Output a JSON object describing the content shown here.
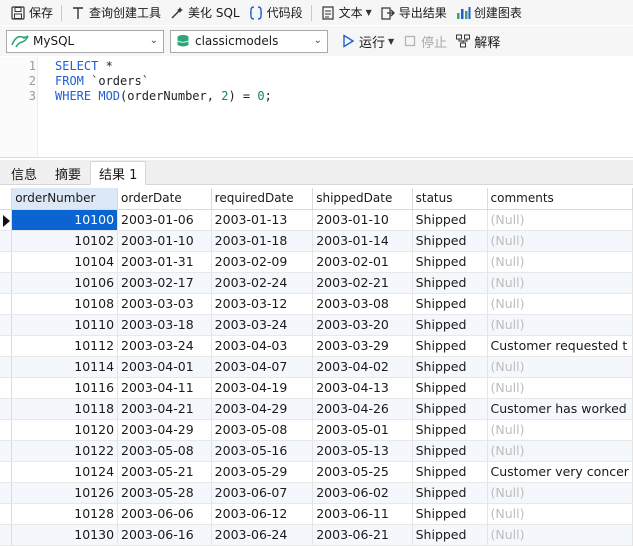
{
  "toolbar": {
    "save": "保存",
    "query_builder": "查询创建工具",
    "beautify_sql": "美化 SQL",
    "code_snippet": "代码段",
    "text": "文本",
    "export_results": "导出结果",
    "create_chart": "创建图表"
  },
  "connection": {
    "server": "MySQL",
    "database": "classicmodels",
    "run": "运行",
    "stop": "停止",
    "explain": "解释"
  },
  "editor": {
    "line_numbers": [
      "1",
      "2",
      "3"
    ],
    "lines": [
      {
        "kw": "SELECT",
        "rest": " *"
      },
      {
        "kw": "FROM",
        "rest": " `orders`"
      },
      {
        "kw": "WHERE",
        "fn": "MOD",
        "args": "(orderNumber, ",
        "num": "2",
        "tail": ") = ",
        "num2": "0",
        "end": ";"
      }
    ]
  },
  "tabs": [
    "信息",
    "摘要",
    "结果 1"
  ],
  "results": {
    "columns": [
      "orderNumber",
      "orderDate",
      "requiredDate",
      "shippedDate",
      "status",
      "comments"
    ],
    "rows": [
      [
        "10100",
        "2003-01-06",
        "2003-01-13",
        "2003-01-10",
        "Shipped",
        "(Null)"
      ],
      [
        "10102",
        "2003-01-10",
        "2003-01-18",
        "2003-01-14",
        "Shipped",
        "(Null)"
      ],
      [
        "10104",
        "2003-01-31",
        "2003-02-09",
        "2003-02-01",
        "Shipped",
        "(Null)"
      ],
      [
        "10106",
        "2003-02-17",
        "2003-02-24",
        "2003-02-21",
        "Shipped",
        "(Null)"
      ],
      [
        "10108",
        "2003-03-03",
        "2003-03-12",
        "2003-03-08",
        "Shipped",
        "(Null)"
      ],
      [
        "10110",
        "2003-03-18",
        "2003-03-24",
        "2003-03-20",
        "Shipped",
        "(Null)"
      ],
      [
        "10112",
        "2003-03-24",
        "2003-04-03",
        "2003-03-29",
        "Shipped",
        "Customer requested t"
      ],
      [
        "10114",
        "2003-04-01",
        "2003-04-07",
        "2003-04-02",
        "Shipped",
        "(Null)"
      ],
      [
        "10116",
        "2003-04-11",
        "2003-04-19",
        "2003-04-13",
        "Shipped",
        "(Null)"
      ],
      [
        "10118",
        "2003-04-21",
        "2003-04-29",
        "2003-04-26",
        "Shipped",
        "Customer has worked"
      ],
      [
        "10120",
        "2003-04-29",
        "2003-05-08",
        "2003-05-01",
        "Shipped",
        "(Null)"
      ],
      [
        "10122",
        "2003-05-08",
        "2003-05-16",
        "2003-05-13",
        "Shipped",
        "(Null)"
      ],
      [
        "10124",
        "2003-05-21",
        "2003-05-29",
        "2003-05-25",
        "Shipped",
        "Customer very concer"
      ],
      [
        "10126",
        "2003-05-28",
        "2003-06-07",
        "2003-06-02",
        "Shipped",
        "(Null)"
      ],
      [
        "10128",
        "2003-06-06",
        "2003-06-12",
        "2003-06-11",
        "Shipped",
        "(Null)"
      ],
      [
        "10130",
        "2003-06-16",
        "2003-06-24",
        "2003-06-21",
        "Shipped",
        "(Null)"
      ]
    ]
  },
  "colors": {
    "selection": "#0a64d2",
    "keyword": "#1f5fd1",
    "number": "#0b8b4d",
    "null_text": "#bdbdbd"
  }
}
